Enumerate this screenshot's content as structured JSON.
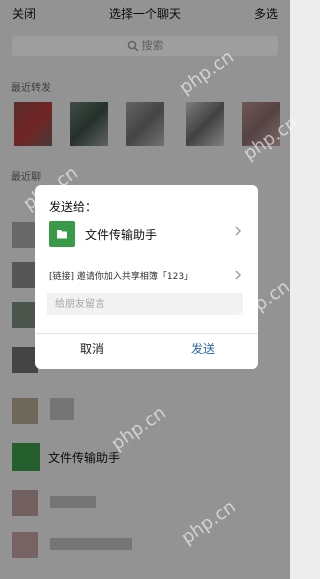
{
  "header": {
    "close": "关闭",
    "title": "选择一个聊天",
    "multi": "多选"
  },
  "search": {
    "placeholder": "搜索"
  },
  "sections": {
    "recent_forward": "最近转发",
    "recent_chats": "最近聊"
  },
  "file_contact": {
    "name": "文件传输助手"
  },
  "dialog": {
    "to_label": "发送给：",
    "target": "文件传输助手",
    "link_text": "[链接] 邀请你加入共享相簿「123」",
    "message_placeholder": "给朋友留言",
    "cancel": "取消",
    "send": "发送"
  },
  "watermarks": [
    "php.cn",
    "php.cn",
    "php.cn",
    "php.cn",
    "php.cn",
    "php.cn"
  ],
  "colors": {
    "wechat_green": "#3a9a4a",
    "send_blue": "#2a64b2"
  }
}
